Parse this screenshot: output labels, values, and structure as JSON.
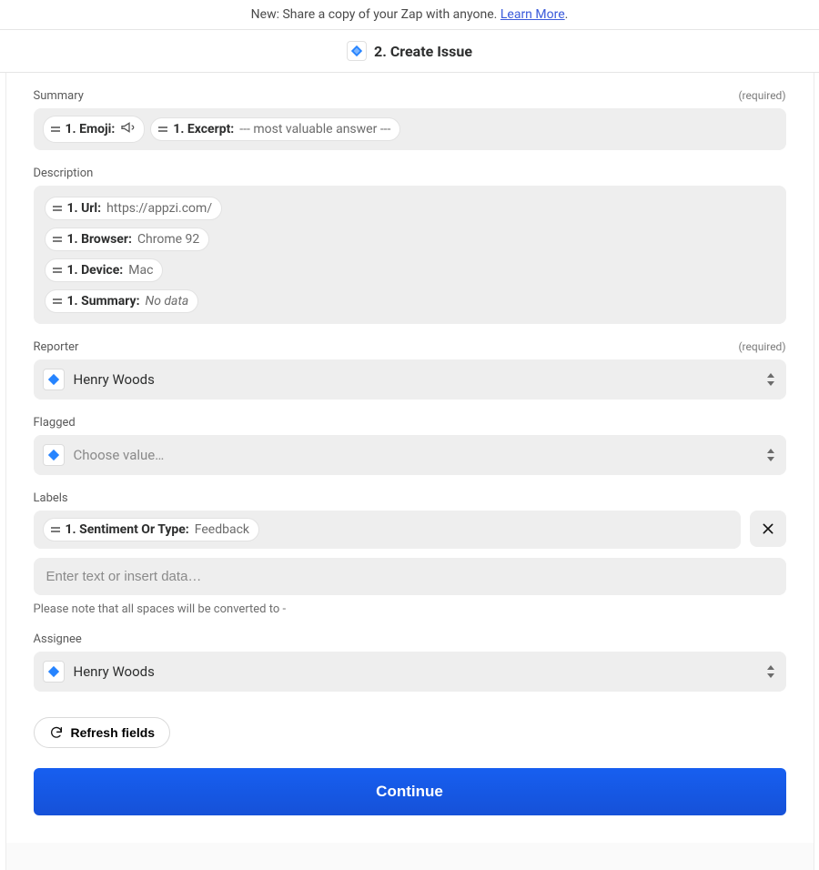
{
  "banner": {
    "prefix": "New: Share a copy of your Zap with anyone. ",
    "link_text": "Learn More",
    "suffix": "."
  },
  "step": {
    "number_title": "2. Create Issue"
  },
  "fields": {
    "summary": {
      "label": "Summary",
      "required": "(required)",
      "pills": [
        {
          "key": "1. Emoji:",
          "value": "",
          "icon": "megaphone"
        },
        {
          "key": "1. Excerpt:",
          "value": "--- most valuable answer ---"
        }
      ]
    },
    "description": {
      "label": "Description",
      "pills": [
        {
          "key": "1. Url:",
          "value": "https://appzi.com/"
        },
        {
          "key": "1. Browser:",
          "value": "Chrome 92"
        },
        {
          "key": "1. Device:",
          "value": "Mac"
        },
        {
          "key": "1. Summary:",
          "value": "No data",
          "nodata": true
        }
      ]
    },
    "reporter": {
      "label": "Reporter",
      "required": "(required)",
      "value": "Henry Woods"
    },
    "flagged": {
      "label": "Flagged",
      "placeholder": "Choose value…"
    },
    "labels": {
      "label": "Labels",
      "pill": {
        "key": "1. Sentiment Or Type:",
        "value": "Feedback"
      },
      "input_placeholder": "Enter text or insert data…",
      "help": "Please note that all spaces will be converted to  -"
    },
    "assignee": {
      "label": "Assignee",
      "value": "Henry Woods"
    }
  },
  "buttons": {
    "refresh": "Refresh fields",
    "continue": "Continue"
  }
}
